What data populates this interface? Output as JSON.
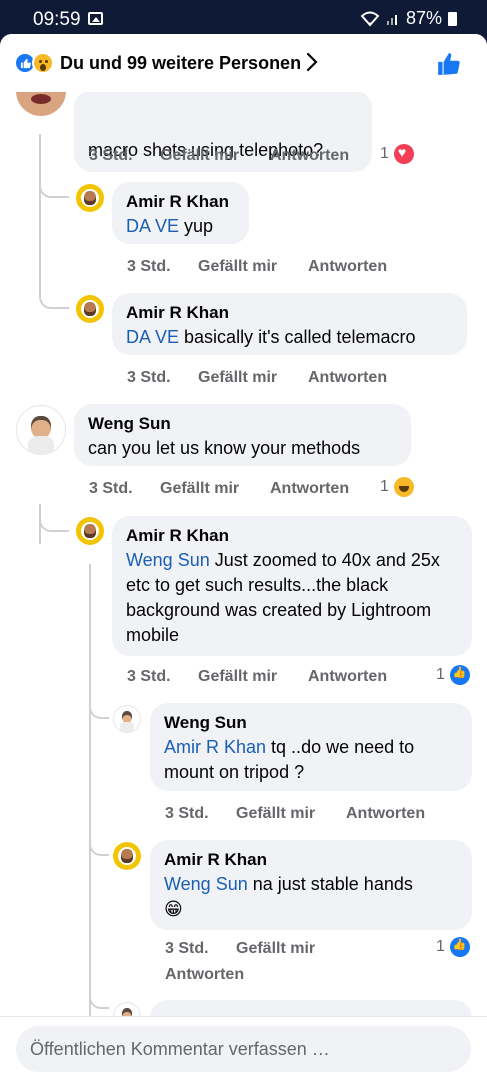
{
  "status": {
    "time": "09:59",
    "battery": "87%"
  },
  "header": {
    "title": "Du und 99 weitere Personen"
  },
  "labels": {
    "time": "3 Std.",
    "like": "Gefällt mir",
    "reply": "Antworten"
  },
  "comments": [
    {
      "text": "macro shots using telephoto?",
      "reactions": "1"
    },
    {
      "name": "Amir R Khan",
      "mention": "DA VE",
      "text": " yup"
    },
    {
      "name": "Amir R Khan",
      "mention": "DA VE",
      "text": " basically it's called telemacro"
    },
    {
      "name": "Weng Sun",
      "text": "can you let us know your methods",
      "reactions": "1"
    },
    {
      "name": "Amir R Khan",
      "mention": "Weng Sun",
      "text": " Just zoomed to 40x and 25x etc to get such results...the black background was created by Lightroom mobile",
      "reactions": "1"
    },
    {
      "name": "Weng Sun",
      "mention": "Amir R Khan",
      "text": " tq ..do we need to mount on tripod ?"
    },
    {
      "name": "Amir R Khan",
      "mention": "Weng Sun",
      "text": " na just stable hands",
      "emoji": "😁",
      "reactions": "1"
    }
  ],
  "composer": {
    "placeholder": "Öffentlichen Kommentar verfassen …"
  }
}
